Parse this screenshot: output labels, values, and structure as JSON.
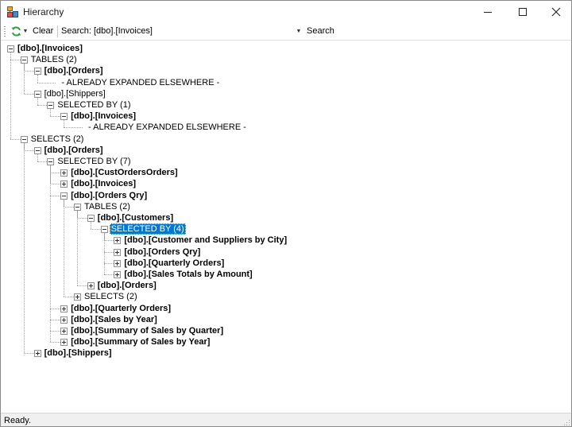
{
  "window": {
    "title": "Hierarchy"
  },
  "toolbar": {
    "clear_label": "Clear",
    "search_label": "Search:",
    "search_value": "[dbo].[Invoices]",
    "search_button": "Search"
  },
  "tree": {
    "nodes": [
      {
        "label": "[dbo].[Invoices]",
        "expanded": true
      },
      {
        "label": "TABLES (2)",
        "expanded": true
      },
      {
        "label": "[dbo].[Orders]",
        "expanded": true
      },
      {
        "label": "- ALREADY EXPANDED ELSEWHERE -"
      },
      {
        "label": "[dbo].[Shippers]",
        "expanded": true
      },
      {
        "label": "SELECTED BY (1)",
        "expanded": true
      },
      {
        "label": "[dbo].[Invoices]",
        "expanded": true
      },
      {
        "label": "- ALREADY EXPANDED ELSEWHERE -"
      },
      {
        "label": "SELECTS (2)",
        "expanded": true
      },
      {
        "label": "[dbo].[Orders]",
        "expanded": true
      },
      {
        "label": "SELECTED BY (7)",
        "expanded": true
      },
      {
        "label": "[dbo].[CustOrdersOrders]",
        "expanded": false
      },
      {
        "label": "[dbo].[Invoices]",
        "expanded": false
      },
      {
        "label": "[dbo].[Orders Qry]",
        "expanded": true
      },
      {
        "label": "TABLES (2)",
        "expanded": true
      },
      {
        "label": "[dbo].[Customers]",
        "expanded": true
      },
      {
        "label": "SELECTED BY (4)",
        "expanded": true,
        "selected": true
      },
      {
        "label": "[dbo].[Customer and Suppliers by City]",
        "expanded": false
      },
      {
        "label": "[dbo].[Orders Qry]",
        "expanded": false
      },
      {
        "label": "[dbo].[Quarterly Orders]",
        "expanded": false
      },
      {
        "label": "[dbo].[Sales Totals by Amount]",
        "expanded": false
      },
      {
        "label": "[dbo].[Orders]",
        "expanded": false
      },
      {
        "label": "SELECTS (2)",
        "expanded": false
      },
      {
        "label": "[dbo].[Quarterly Orders]",
        "expanded": false
      },
      {
        "label": "[dbo].[Sales by Year]",
        "expanded": false
      },
      {
        "label": "[dbo].[Summary of Sales by Quarter]",
        "expanded": false
      },
      {
        "label": "[dbo].[Summary of Sales by Year]",
        "expanded": false
      },
      {
        "label": "[dbo].[Shippers]",
        "expanded": false
      }
    ]
  },
  "status": {
    "text": "Ready."
  },
  "colors": {
    "selection": "#0078d7",
    "tree_lines": "#a0a0a0",
    "statusbar": "#f0f0f0"
  },
  "icons": {
    "app": "hierarchy-app-icon",
    "refresh": "refresh-icon",
    "minimize": "minimize-icon",
    "maximize": "maximize-icon",
    "close": "close-icon"
  }
}
